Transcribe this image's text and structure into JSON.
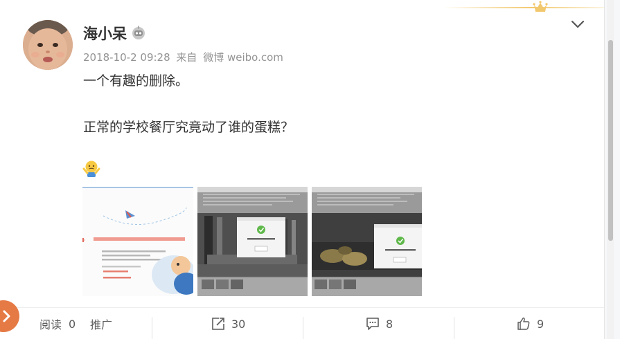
{
  "post": {
    "username": "海小呆",
    "timestamp": "2018-10-2 09:28",
    "source_prefix": "来自",
    "source_app": "微博 weibo.com",
    "text_line1": "一个有趣的删除。",
    "text_line2": "正常的学校餐厅究竟动了谁的蛋糕？",
    "emoji_name": "shrug-emoji",
    "images": [
      {
        "name": "error-page-screenshot",
        "error_text": "抱歉，您访问的页面地址有误，或者该页面不存在"
      },
      {
        "name": "deleted-post-screenshot-1",
        "dialog_text": "抱歉，此微博已被删除。",
        "dialog_button": "确定"
      },
      {
        "name": "deleted-post-screenshot-2",
        "dialog_text": "抱歉，此微博已被删除。",
        "dialog_button": "确定"
      }
    ]
  },
  "actions": {
    "read_label": "阅读",
    "read_count": "0",
    "promote_label": "推广",
    "repost_count": "30",
    "comment_count": "8",
    "like_count": "9"
  },
  "colors": {
    "text": "#333333",
    "meta": "#939393",
    "crown": "#f2c86e",
    "float_button": "#e57a45"
  }
}
